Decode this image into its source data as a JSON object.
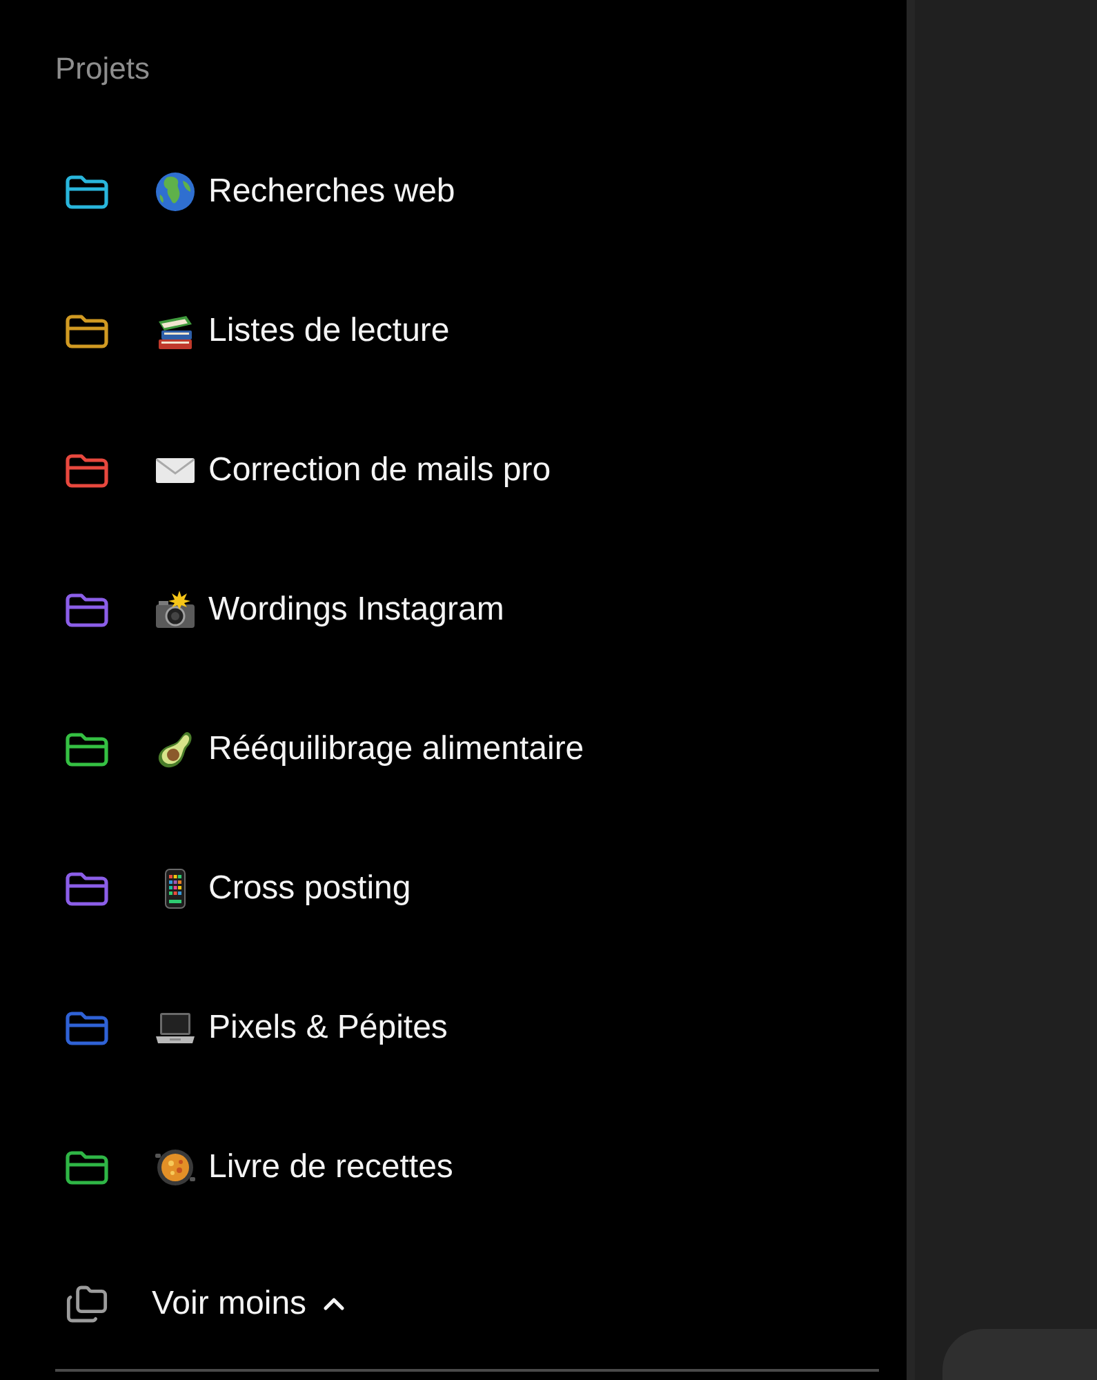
{
  "sidebar": {
    "section_title": "Projets",
    "projects": [
      {
        "kind": "globe",
        "label": "Recherches web",
        "color": "#29b6dc"
      },
      {
        "kind": "books",
        "label": "Listes de lecture",
        "color": "#d19a22"
      },
      {
        "kind": "envelope",
        "label": "Correction de mails pro",
        "color": "#e8483e"
      },
      {
        "kind": "camera",
        "label": "Wordings Instagram",
        "color": "#8b5ee8"
      },
      {
        "kind": "avocado",
        "label": "Rééquilibrage alimentaire",
        "color": "#35c043"
      },
      {
        "kind": "phone",
        "label": "Cross posting",
        "color": "#8b5ee8"
      },
      {
        "kind": "laptop",
        "label": "Pixels & Pépites",
        "color": "#2f62d6"
      },
      {
        "kind": "paella",
        "label": "Livre de recettes",
        "color": "#2fb646"
      }
    ],
    "toggle": {
      "label": "Voir moins",
      "expanded": true
    }
  }
}
